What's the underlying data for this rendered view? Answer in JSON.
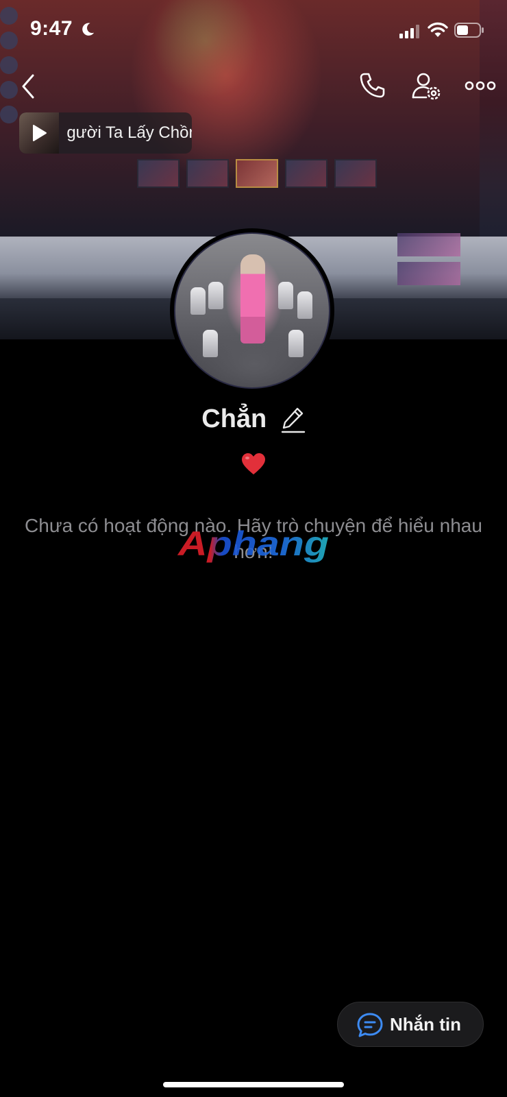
{
  "status_bar": {
    "time": "9:47"
  },
  "music": {
    "title": "Người Ta Lấy Chồng"
  },
  "profile": {
    "name": "Chẳn",
    "bio_emoji": "heart",
    "empty_message": "Chưa có hoạt động nào. Hãy trò chuyện để hiểu nhau hơn!"
  },
  "actions": {
    "message_label": "Nhắn tin"
  },
  "watermark": {
    "text": "Aphang"
  },
  "colors": {
    "background": "#000000",
    "accent_blue": "#3d8bf2",
    "heart_red": "#e2303a",
    "muted_text": "#8d8d91"
  },
  "icons": [
    "moon-icon",
    "signal-icon",
    "wifi-icon",
    "battery-icon",
    "back-icon",
    "phone-icon",
    "profile-settings-icon",
    "more-icon",
    "play-icon",
    "pencil-icon",
    "heart-icon",
    "chat-icon"
  ]
}
